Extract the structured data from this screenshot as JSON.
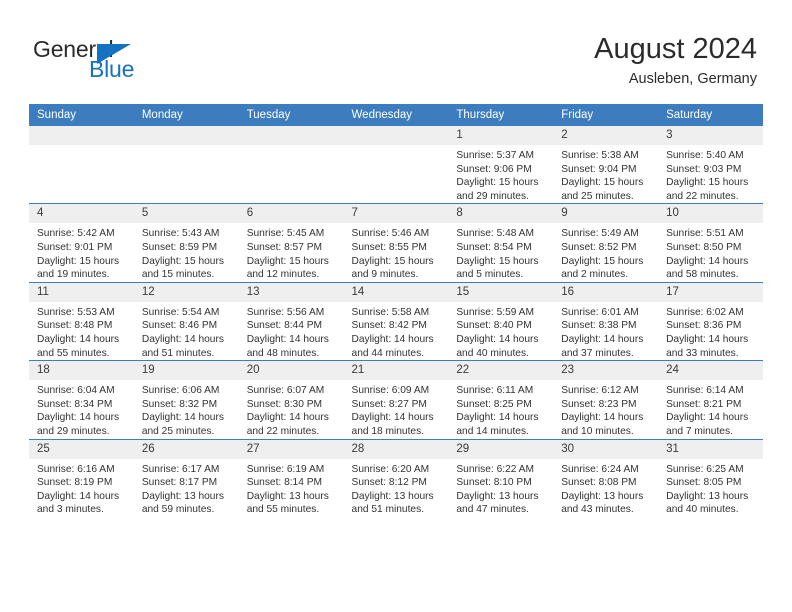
{
  "brand": {
    "name_part1": "General",
    "name_part2": "Blue",
    "triangle_color": "#1572c0",
    "text_color": "#2b2b2b"
  },
  "header": {
    "title": "August 2024",
    "subtitle": "Ausleben, Germany",
    "accent_color": "#3c7cbf",
    "daynum_band_color": "#efefef"
  },
  "calendar": {
    "weekday_headers": [
      "Sunday",
      "Monday",
      "Tuesday",
      "Wednesday",
      "Thursday",
      "Friday",
      "Saturday"
    ],
    "weeks": [
      [
        {
          "day": "",
          "empty": true,
          "lines": []
        },
        {
          "day": "",
          "empty": true,
          "lines": []
        },
        {
          "day": "",
          "empty": true,
          "lines": []
        },
        {
          "day": "",
          "empty": true,
          "lines": []
        },
        {
          "day": "1",
          "lines": [
            "Sunrise: 5:37 AM",
            "Sunset: 9:06 PM",
            "Daylight: 15 hours",
            "and 29 minutes."
          ]
        },
        {
          "day": "2",
          "lines": [
            "Sunrise: 5:38 AM",
            "Sunset: 9:04 PM",
            "Daylight: 15 hours",
            "and 25 minutes."
          ]
        },
        {
          "day": "3",
          "lines": [
            "Sunrise: 5:40 AM",
            "Sunset: 9:03 PM",
            "Daylight: 15 hours",
            "and 22 minutes."
          ]
        }
      ],
      [
        {
          "day": "4",
          "lines": [
            "Sunrise: 5:42 AM",
            "Sunset: 9:01 PM",
            "Daylight: 15 hours",
            "and 19 minutes."
          ]
        },
        {
          "day": "5",
          "lines": [
            "Sunrise: 5:43 AM",
            "Sunset: 8:59 PM",
            "Daylight: 15 hours",
            "and 15 minutes."
          ]
        },
        {
          "day": "6",
          "lines": [
            "Sunrise: 5:45 AM",
            "Sunset: 8:57 PM",
            "Daylight: 15 hours",
            "and 12 minutes."
          ]
        },
        {
          "day": "7",
          "lines": [
            "Sunrise: 5:46 AM",
            "Sunset: 8:55 PM",
            "Daylight: 15 hours",
            "and 9 minutes."
          ]
        },
        {
          "day": "8",
          "lines": [
            "Sunrise: 5:48 AM",
            "Sunset: 8:54 PM",
            "Daylight: 15 hours",
            "and 5 minutes."
          ]
        },
        {
          "day": "9",
          "lines": [
            "Sunrise: 5:49 AM",
            "Sunset: 8:52 PM",
            "Daylight: 15 hours",
            "and 2 minutes."
          ]
        },
        {
          "day": "10",
          "lines": [
            "Sunrise: 5:51 AM",
            "Sunset: 8:50 PM",
            "Daylight: 14 hours",
            "and 58 minutes."
          ]
        }
      ],
      [
        {
          "day": "11",
          "lines": [
            "Sunrise: 5:53 AM",
            "Sunset: 8:48 PM",
            "Daylight: 14 hours",
            "and 55 minutes."
          ]
        },
        {
          "day": "12",
          "lines": [
            "Sunrise: 5:54 AM",
            "Sunset: 8:46 PM",
            "Daylight: 14 hours",
            "and 51 minutes."
          ]
        },
        {
          "day": "13",
          "lines": [
            "Sunrise: 5:56 AM",
            "Sunset: 8:44 PM",
            "Daylight: 14 hours",
            "and 48 minutes."
          ]
        },
        {
          "day": "14",
          "lines": [
            "Sunrise: 5:58 AM",
            "Sunset: 8:42 PM",
            "Daylight: 14 hours",
            "and 44 minutes."
          ]
        },
        {
          "day": "15",
          "lines": [
            "Sunrise: 5:59 AM",
            "Sunset: 8:40 PM",
            "Daylight: 14 hours",
            "and 40 minutes."
          ]
        },
        {
          "day": "16",
          "lines": [
            "Sunrise: 6:01 AM",
            "Sunset: 8:38 PM",
            "Daylight: 14 hours",
            "and 37 minutes."
          ]
        },
        {
          "day": "17",
          "lines": [
            "Sunrise: 6:02 AM",
            "Sunset: 8:36 PM",
            "Daylight: 14 hours",
            "and 33 minutes."
          ]
        }
      ],
      [
        {
          "day": "18",
          "lines": [
            "Sunrise: 6:04 AM",
            "Sunset: 8:34 PM",
            "Daylight: 14 hours",
            "and 29 minutes."
          ]
        },
        {
          "day": "19",
          "lines": [
            "Sunrise: 6:06 AM",
            "Sunset: 8:32 PM",
            "Daylight: 14 hours",
            "and 25 minutes."
          ]
        },
        {
          "day": "20",
          "lines": [
            "Sunrise: 6:07 AM",
            "Sunset: 8:30 PM",
            "Daylight: 14 hours",
            "and 22 minutes."
          ]
        },
        {
          "day": "21",
          "lines": [
            "Sunrise: 6:09 AM",
            "Sunset: 8:27 PM",
            "Daylight: 14 hours",
            "and 18 minutes."
          ]
        },
        {
          "day": "22",
          "lines": [
            "Sunrise: 6:11 AM",
            "Sunset: 8:25 PM",
            "Daylight: 14 hours",
            "and 14 minutes."
          ]
        },
        {
          "day": "23",
          "lines": [
            "Sunrise: 6:12 AM",
            "Sunset: 8:23 PM",
            "Daylight: 14 hours",
            "and 10 minutes."
          ]
        },
        {
          "day": "24",
          "lines": [
            "Sunrise: 6:14 AM",
            "Sunset: 8:21 PM",
            "Daylight: 14 hours",
            "and 7 minutes."
          ]
        }
      ],
      [
        {
          "day": "25",
          "lines": [
            "Sunrise: 6:16 AM",
            "Sunset: 8:19 PM",
            "Daylight: 14 hours",
            "and 3 minutes."
          ]
        },
        {
          "day": "26",
          "lines": [
            "Sunrise: 6:17 AM",
            "Sunset: 8:17 PM",
            "Daylight: 13 hours",
            "and 59 minutes."
          ]
        },
        {
          "day": "27",
          "lines": [
            "Sunrise: 6:19 AM",
            "Sunset: 8:14 PM",
            "Daylight: 13 hours",
            "and 55 minutes."
          ]
        },
        {
          "day": "28",
          "lines": [
            "Sunrise: 6:20 AM",
            "Sunset: 8:12 PM",
            "Daylight: 13 hours",
            "and 51 minutes."
          ]
        },
        {
          "day": "29",
          "lines": [
            "Sunrise: 6:22 AM",
            "Sunset: 8:10 PM",
            "Daylight: 13 hours",
            "and 47 minutes."
          ]
        },
        {
          "day": "30",
          "lines": [
            "Sunrise: 6:24 AM",
            "Sunset: 8:08 PM",
            "Daylight: 13 hours",
            "and 43 minutes."
          ]
        },
        {
          "day": "31",
          "lines": [
            "Sunrise: 6:25 AM",
            "Sunset: 8:05 PM",
            "Daylight: 13 hours",
            "and 40 minutes."
          ]
        }
      ]
    ]
  }
}
